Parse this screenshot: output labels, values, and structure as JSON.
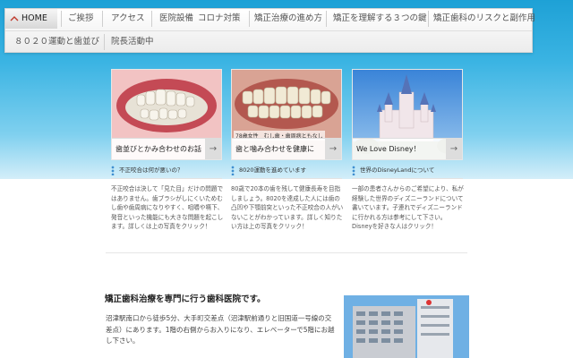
{
  "nav": {
    "items": [
      "HOME",
      "ご挨拶",
      "アクセス",
      "医院設備",
      "コロナ対策",
      "矯正治療の進め方",
      "矯正を理解する３つの鍵",
      "矯正歯科のリスクと副作用",
      "８０２０運動と歯並び",
      "院長活動中"
    ]
  },
  "cards": [
    {
      "banner": "歯並びとかみ合わせのお話",
      "heading": "不正咬合は何が悪いの？",
      "desc": "不正咬合は決して「見た目」だけの問題ではありません。歯ブラシがしにくいためむし歯や歯周病になりやすく、咀嚼や嚥下、発音といった機能にも大きな問題を起こします。詳しくは上の写真をクリック！"
    },
    {
      "banner": "歯と噛み合わせを健康に",
      "photo_caption": "78歳女性　むし歯・歯周病ともなし",
      "heading": "8020運動を進めています",
      "desc": "80歳で20本の歯を残して健康長寿を目指しましょう。8020を達成した人には歯の凸凹や下顎前突といった不正咬合の人がいないことがわかっています。詳しく知りたい方は上の写真をクリック！"
    },
    {
      "banner": "We Love Disney！",
      "heading": "世界のDisneyLandについて",
      "desc": "一部の患者さんからのご希望により、私が経験した世界のディズニーランドについて書いています。子連れでディズニーランドに行かれる方は参考にして下さい。Disneyを好きな人はクリック！"
    }
  ],
  "main": {
    "heading": "矯正歯科治療を専門に行う歯科医院です。",
    "text": "沼津駅南口から徒歩5分、大手町交差点（沼津駅前通りと旧国道一号線の交差点）にあります。1階の右側からお入りになり、エレベーターで5階にお越し下さい。"
  },
  "colors": {
    "accent": "#3f8fd0",
    "sky": "#1ea1d6"
  }
}
